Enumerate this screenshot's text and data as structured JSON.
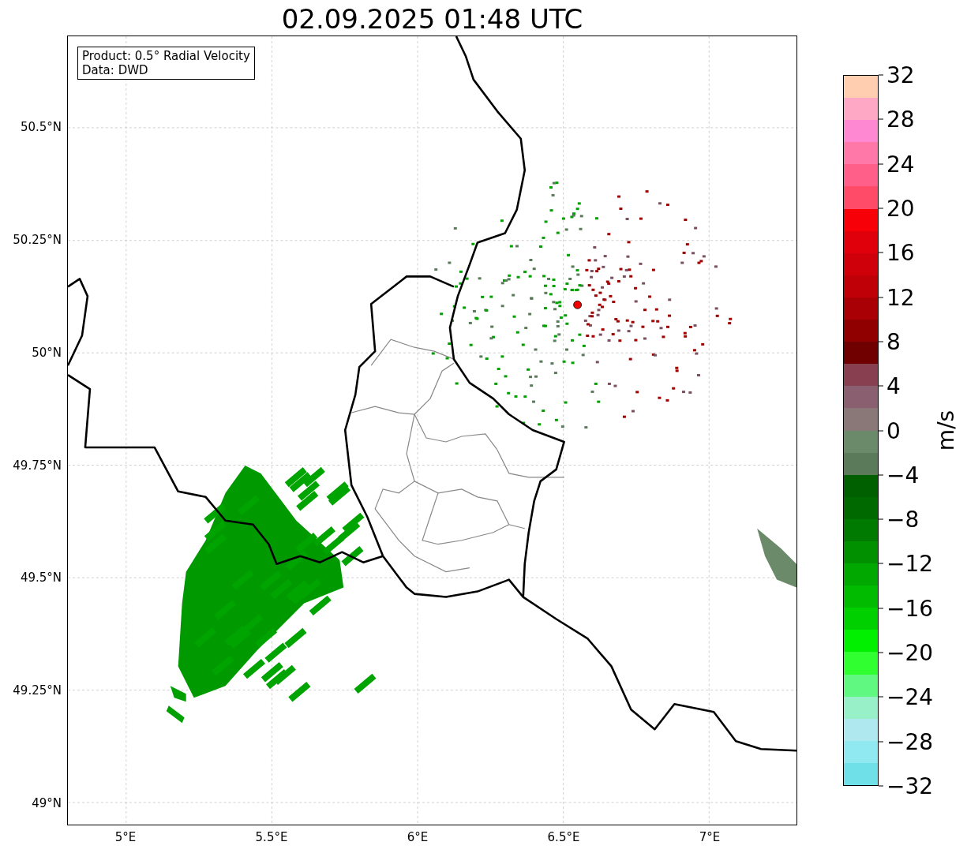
{
  "title": "02.09.2025 01:48 UTC",
  "info_box": {
    "lines": [
      "Product: 0.5° Radial Velocity",
      "Data: DWD"
    ]
  },
  "map": {
    "lat_ticks": [
      "50.5°N",
      "50.25°N",
      "50°N",
      "49.75°N",
      "49.5°N",
      "49.25°N",
      "49°N"
    ],
    "lon_ticks": [
      "5°E",
      "5.5°E",
      "6°E",
      "6.5°E",
      "7°E"
    ]
  },
  "colorbar": {
    "label": "m/s",
    "ticks": [
      "32",
      "28",
      "24",
      "20",
      "16",
      "12",
      "8",
      "4",
      "0",
      "−4",
      "−8",
      "−12",
      "−16",
      "−20",
      "−24",
      "−28",
      "−32"
    ],
    "bands": [
      {
        "color": "#ffcdb0"
      },
      {
        "color": "#ffa8c6"
      },
      {
        "color": "#ff88d2"
      },
      {
        "color": "#ff78a8"
      },
      {
        "color": "#ff5f88"
      },
      {
        "color": "#ff4a68"
      },
      {
        "color": "#f80008"
      },
      {
        "color": "#e0000c"
      },
      {
        "color": "#d0000a"
      },
      {
        "color": "#bf0006"
      },
      {
        "color": "#a80004"
      },
      {
        "color": "#900000"
      },
      {
        "color": "#700000"
      },
      {
        "color": "#884050"
      },
      {
        "color": "#8a6070"
      },
      {
        "color": "#8a7878"
      },
      {
        "color": "#6a8a6a"
      },
      {
        "color": "#5a7a5a"
      },
      {
        "color": "#006000"
      },
      {
        "color": "#006a00"
      },
      {
        "color": "#007a00"
      },
      {
        "color": "#009000"
      },
      {
        "color": "#00a800"
      },
      {
        "color": "#00bb00"
      },
      {
        "color": "#00d000"
      },
      {
        "color": "#00f000"
      },
      {
        "color": "#30ff30"
      },
      {
        "color": "#60f880"
      },
      {
        "color": "#98f0c8"
      },
      {
        "color": "#b0e8f0"
      },
      {
        "color": "#90e8f0"
      },
      {
        "color": "#70e0e8"
      }
    ]
  }
}
